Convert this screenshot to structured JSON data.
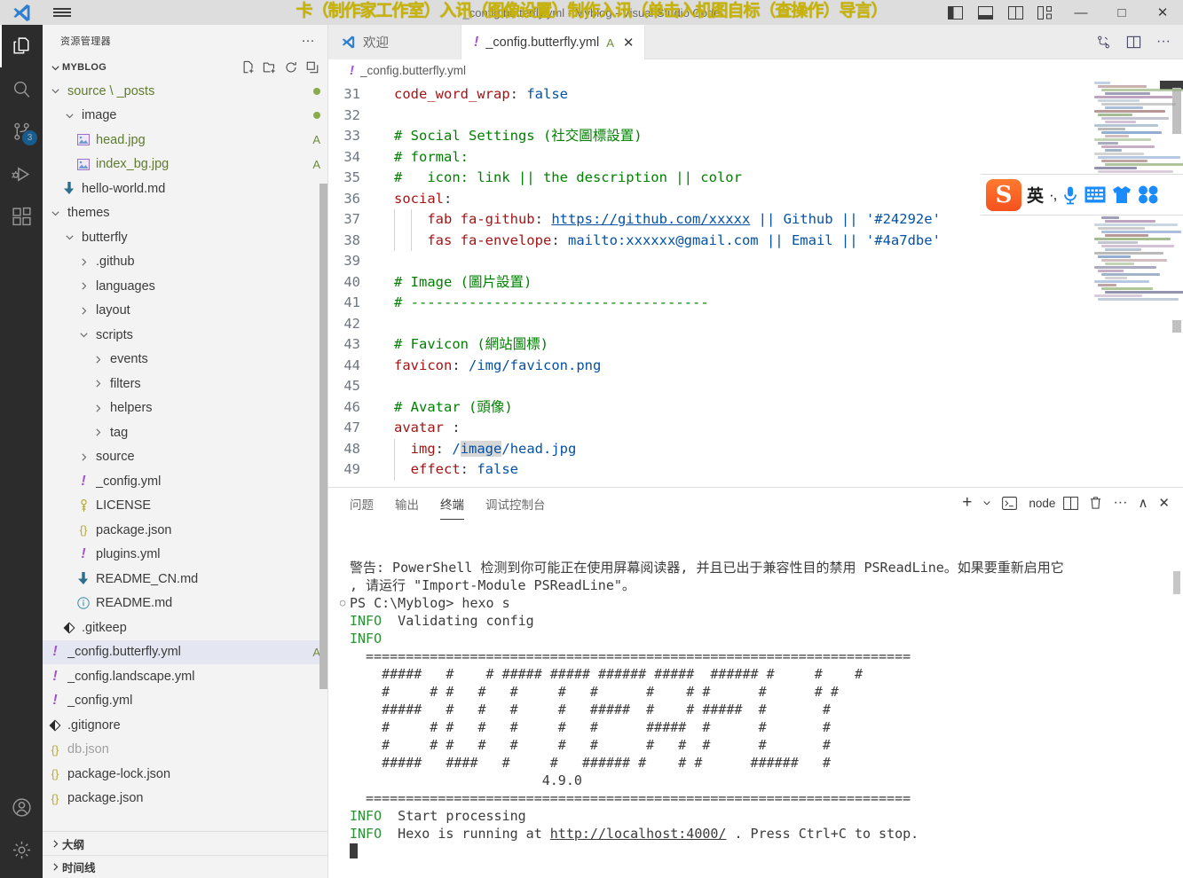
{
  "window": {
    "title_real": "_config.butterfly.yml - Myblog - Visual Studio Code",
    "title_overlay": "卡（制作家工作室）入讯（图像设置）制作入讯（单击入机图自标（查操作）导言）",
    "controls": {
      "minimize": "—",
      "maximize": "□",
      "close": "✕"
    },
    "layout_toggles": [
      "toggle-primary-sidebar",
      "toggle-panel",
      "toggle-secondary-sidebar",
      "customize-layout"
    ]
  },
  "activitybar": {
    "items": [
      {
        "name": "explorer",
        "icon": "files-icon",
        "active": true,
        "badge": ""
      },
      {
        "name": "search",
        "icon": "search-icon",
        "active": false,
        "badge": ""
      },
      {
        "name": "source-control",
        "icon": "source-control-icon",
        "active": false,
        "badge": "3"
      },
      {
        "name": "run-and-debug",
        "icon": "debug-icon",
        "active": false,
        "badge": ""
      },
      {
        "name": "extensions",
        "icon": "extensions-icon",
        "active": false,
        "badge": ""
      }
    ],
    "bottom": [
      {
        "name": "accounts",
        "icon": "account-icon"
      },
      {
        "name": "manage",
        "icon": "gear-icon"
      }
    ]
  },
  "sidebar": {
    "title": "资源管理器",
    "more_actions": "···",
    "root": {
      "label": "MYBLOG",
      "actions": [
        "new-file-icon",
        "new-folder-icon",
        "refresh-icon",
        "collapse-all-icon"
      ]
    },
    "tree": [
      {
        "label": "source \\ _posts",
        "indent": 1,
        "type": "folder",
        "expanded": true,
        "badge": "dot",
        "style": "greenish"
      },
      {
        "label": "image",
        "indent": 2,
        "type": "folder",
        "expanded": true,
        "badge": "dot",
        "style": ""
      },
      {
        "label": "head.jpg",
        "indent": 3,
        "type": "image",
        "badge": "A",
        "style": "greenish"
      },
      {
        "label": "index_bg.jpg",
        "indent": 3,
        "type": "image",
        "badge": "A",
        "style": "greenish"
      },
      {
        "label": "hello-world.md",
        "indent": 2,
        "type": "markdown",
        "badge": "",
        "style": ""
      },
      {
        "label": "themes",
        "indent": 1,
        "type": "folder",
        "expanded": true,
        "badge": "",
        "style": ""
      },
      {
        "label": "butterfly",
        "indent": 2,
        "type": "folder",
        "expanded": true,
        "badge": "",
        "style": ""
      },
      {
        "label": ".github",
        "indent": 3,
        "type": "folder",
        "expanded": false,
        "badge": "",
        "style": ""
      },
      {
        "label": "languages",
        "indent": 3,
        "type": "folder",
        "expanded": false,
        "badge": "",
        "style": ""
      },
      {
        "label": "layout",
        "indent": 3,
        "type": "folder",
        "expanded": false,
        "badge": "",
        "style": ""
      },
      {
        "label": "scripts",
        "indent": 3,
        "type": "folder",
        "expanded": true,
        "badge": "",
        "style": ""
      },
      {
        "label": "events",
        "indent": 4,
        "type": "folder",
        "expanded": false,
        "badge": "",
        "style": ""
      },
      {
        "label": "filters",
        "indent": 4,
        "type": "folder",
        "expanded": false,
        "badge": "",
        "style": ""
      },
      {
        "label": "helpers",
        "indent": 4,
        "type": "folder",
        "expanded": false,
        "badge": "",
        "style": ""
      },
      {
        "label": "tag",
        "indent": 4,
        "type": "folder",
        "expanded": false,
        "badge": "",
        "style": ""
      },
      {
        "label": "source",
        "indent": 3,
        "type": "folder",
        "expanded": false,
        "badge": "",
        "style": ""
      },
      {
        "label": "_config.yml",
        "indent": 3,
        "type": "yml",
        "badge": "",
        "style": ""
      },
      {
        "label": "LICENSE",
        "indent": 3,
        "type": "license",
        "badge": "",
        "style": ""
      },
      {
        "label": "package.json",
        "indent": 3,
        "type": "json",
        "badge": "",
        "style": ""
      },
      {
        "label": "plugins.yml",
        "indent": 3,
        "type": "yml",
        "badge": "",
        "style": ""
      },
      {
        "label": "README_CN.md",
        "indent": 3,
        "type": "markdown",
        "badge": "",
        "style": ""
      },
      {
        "label": "README.md",
        "indent": 3,
        "type": "info",
        "badge": "",
        "style": ""
      },
      {
        "label": ".gitkeep",
        "indent": 2,
        "type": "git",
        "badge": "",
        "style": ""
      },
      {
        "label": "_config.butterfly.yml",
        "indent": 1,
        "type": "yml",
        "badge": "A",
        "style": "",
        "selected": true
      },
      {
        "label": "_config.landscape.yml",
        "indent": 1,
        "type": "yml",
        "badge": "",
        "style": ""
      },
      {
        "label": "_config.yml",
        "indent": 1,
        "type": "yml",
        "badge": "",
        "style": ""
      },
      {
        "label": ".gitignore",
        "indent": 1,
        "type": "git",
        "badge": "",
        "style": ""
      },
      {
        "label": "db.json",
        "indent": 1,
        "type": "json",
        "badge": "",
        "style": "dim"
      },
      {
        "label": "package-lock.json",
        "indent": 1,
        "type": "json",
        "badge": "",
        "style": ""
      },
      {
        "label": "package.json",
        "indent": 1,
        "type": "json",
        "badge": "",
        "style": ""
      }
    ],
    "bottom_sections": [
      {
        "label": "大纲"
      },
      {
        "label": "时间线"
      }
    ]
  },
  "editor": {
    "tabs": [
      {
        "label": "欢迎",
        "icon": "vscode-icon",
        "active": false,
        "mark": "",
        "closable": false
      },
      {
        "label": "_config.butterfly.yml",
        "icon": "yml-icon",
        "active": true,
        "mark": "A",
        "closable": true
      }
    ],
    "tab_actions": [
      "compare-changes-icon",
      "split-editor-icon",
      "more-actions-icon"
    ],
    "breadcrumb": {
      "icon": "yml-icon",
      "label": "_config.butterfly.yml"
    },
    "first_line_number": 31,
    "lines": [
      {
        "n": 31,
        "tokens": [
          {
            "t": "code_word_wrap",
            "c": "key"
          },
          {
            "t": ": ",
            "c": "punc"
          },
          {
            "t": "false",
            "c": "val"
          }
        ]
      },
      {
        "n": 32,
        "tokens": []
      },
      {
        "n": 33,
        "tokens": [
          {
            "t": "# Social Settings (社交圖標設置)",
            "c": "com"
          }
        ]
      },
      {
        "n": 34,
        "tokens": [
          {
            "t": "# formal:",
            "c": "com"
          }
        ]
      },
      {
        "n": 35,
        "tokens": [
          {
            "t": "#   icon: link || the description || color",
            "c": "com"
          }
        ]
      },
      {
        "n": 36,
        "tokens": [
          {
            "t": "social",
            "c": "key"
          },
          {
            "t": ":",
            "c": "punc"
          }
        ]
      },
      {
        "n": 37,
        "tokens": [
          {
            "t": "    fab fa-github",
            "c": "key"
          },
          {
            "t": ": ",
            "c": "punc"
          },
          {
            "t": "https://github.com/xxxxx",
            "c": "link"
          },
          {
            "t": " || Github || '#24292e'",
            "c": "val"
          }
        ],
        "guides": 2
      },
      {
        "n": 38,
        "tokens": [
          {
            "t": "    fas fa-envelope",
            "c": "key"
          },
          {
            "t": ": ",
            "c": "punc"
          },
          {
            "t": "mailto:xxxxxx@gmail.com || Email || '#4a7dbe'",
            "c": "val"
          }
        ],
        "guides": 2
      },
      {
        "n": 39,
        "tokens": []
      },
      {
        "n": 40,
        "tokens": [
          {
            "t": "# Image (圖片設置)",
            "c": "com"
          }
        ]
      },
      {
        "n": 41,
        "tokens": [
          {
            "t": "# ------------------------------------",
            "c": "com"
          }
        ]
      },
      {
        "n": 42,
        "tokens": []
      },
      {
        "n": 43,
        "tokens": [
          {
            "t": "# Favicon (網站圖標)",
            "c": "com"
          }
        ]
      },
      {
        "n": 44,
        "tokens": [
          {
            "t": "favicon",
            "c": "key"
          },
          {
            "t": ": ",
            "c": "punc"
          },
          {
            "t": "/img/favicon.png",
            "c": "val"
          }
        ]
      },
      {
        "n": 45,
        "tokens": []
      },
      {
        "n": 46,
        "tokens": [
          {
            "t": "# Avatar (頭像)",
            "c": "com"
          }
        ]
      },
      {
        "n": 47,
        "tokens": [
          {
            "t": "avatar",
            "c": "key"
          },
          {
            "t": " :",
            "c": "punc"
          }
        ]
      },
      {
        "n": 48,
        "tokens": [
          {
            "t": "  img",
            "c": "key"
          },
          {
            "t": ": ",
            "c": "punc"
          },
          {
            "t": "/",
            "c": "val"
          },
          {
            "t": "image",
            "c": "val-hl"
          },
          {
            "t": "/head.jpg",
            "c": "val"
          }
        ],
        "guides": 1
      },
      {
        "n": 49,
        "tokens": [
          {
            "t": "  effect",
            "c": "key"
          },
          {
            "t": ": ",
            "c": "punc"
          },
          {
            "t": "false",
            "c": "val"
          }
        ],
        "guides": 1
      }
    ]
  },
  "panel": {
    "tabs": [
      {
        "label": "问题",
        "active": false
      },
      {
        "label": "输出",
        "active": false
      },
      {
        "label": "终端",
        "active": true
      },
      {
        "label": "调试控制台",
        "active": false
      }
    ],
    "actions": {
      "new_terminal": "+",
      "dropdown": "⌄",
      "terminal_name": "node",
      "split": "split-terminal-icon",
      "kill": "trash-icon",
      "views": "···",
      "maximize": "∧",
      "close": "✕"
    },
    "terminal_lines": [
      {
        "text": "警告: PowerShell 检测到你可能正在使用屏幕阅读器, 并且已出于兼容性目的禁用 PSReadLine。如果要重新启用它",
        "type": "plain"
      },
      {
        "text": ", 请运行 \"Import-Module PSReadLine\"。",
        "type": "plain"
      },
      {
        "text": "",
        "type": "plain"
      },
      {
        "text": "PS C:\\Myblog> hexo s",
        "type": "prompt"
      },
      {
        "text": "INFO  Validating config",
        "type": "info"
      },
      {
        "text": "INFO",
        "type": "info"
      },
      {
        "text": "  ====================================================================",
        "type": "plain"
      },
      {
        "text": "    #####   #    # ##### ##### ###### #####  ###### #     #    #",
        "type": "plain"
      },
      {
        "text": "    #     # #   #   #     #   #      #    # #      #      # #",
        "type": "plain"
      },
      {
        "text": "    #####   #   #   #     #   #####  #    # #####  #       #",
        "type": "plain"
      },
      {
        "text": "    #     # #   #   #     #   #      #####  #      #       #",
        "type": "plain"
      },
      {
        "text": "    #     # #   #   #     #   #      #   #  #      #       #",
        "type": "plain"
      },
      {
        "text": "    #####   ####   #     #   ###### #    # #      ######   #",
        "type": "plain"
      },
      {
        "text": "                        4.9.0",
        "type": "plain"
      },
      {
        "text": "  ====================================================================",
        "type": "plain"
      },
      {
        "text": "INFO  Start processing",
        "type": "info"
      },
      {
        "text": "INFO  Hexo is running at http://localhost:4000/ . Press Ctrl+C to stop.",
        "type": "info-link"
      }
    ],
    "hexo_version": "4.9.0",
    "hexo_url": "http://localhost:4000/"
  },
  "ime": {
    "name": "sogou-input-method",
    "logo": "S",
    "mode_label": "英",
    "items": [
      "punctuation-toggle",
      "voice-input-icon",
      "soft-keyboard-icon",
      "skin-icon",
      "toolbox-icon"
    ]
  },
  "colors": {
    "accent": "#0a7aca",
    "activitybar_bg": "#2c2c2c",
    "sidebar_bg": "#f3f3f3",
    "titlebar_bg": "#dddddd",
    "selection_bg": "#e4e6f1",
    "git_added": "#6f8b3f",
    "terminal_info": "#2a9134",
    "comment": "#008000",
    "yaml_key": "#a31515",
    "yaml_value": "#0451a5",
    "overlay_text": "#c8b400",
    "ime_logo": "#f4511e"
  }
}
